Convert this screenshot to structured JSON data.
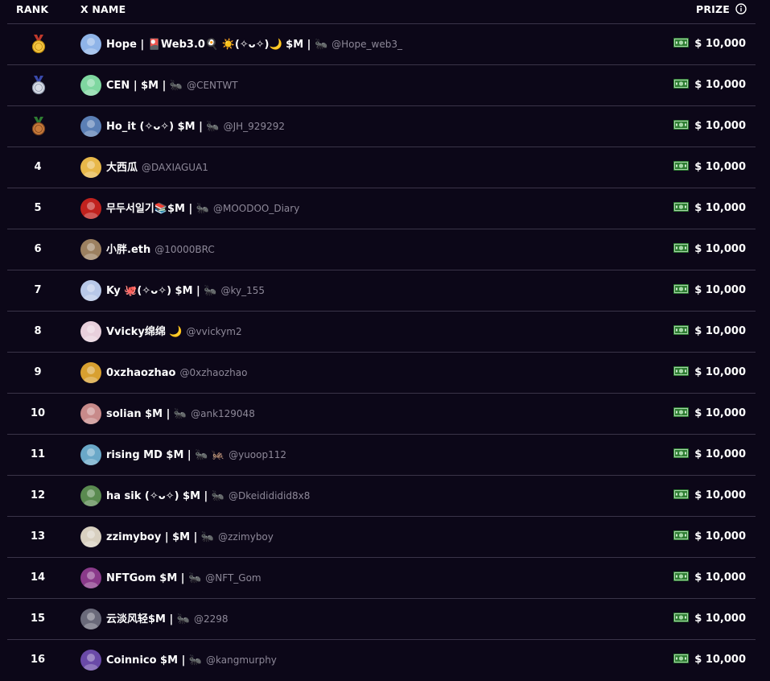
{
  "header": {
    "rank": "RANK",
    "name": "X NAME",
    "prize": "PRIZE"
  },
  "rows": [
    {
      "rank": "1",
      "medal": "gold-medal-icon",
      "name": "Hope | 🎴Web3.0🍳 ☀️(✧ᴗ✧)🌙 $M | 🐜",
      "handle": "@Hope_web3_",
      "prize": "$ 10,000",
      "avatar_color": "#8fb4e8"
    },
    {
      "rank": "2",
      "medal": "silver-medal-icon",
      "name": "CEN | $M | 🐜",
      "handle": "@CENTWT",
      "prize": "$ 10,000",
      "avatar_color": "#7fd7a0"
    },
    {
      "rank": "3",
      "medal": "bronze-medal-icon",
      "name": "Ho_it (✧ᴗ✧) $M | 🐜",
      "handle": "@JH_929292",
      "prize": "$ 10,000",
      "avatar_color": "#5b7fb5"
    },
    {
      "rank": "4",
      "name": "大西瓜",
      "handle": "@DAXIAGUA1",
      "prize": "$ 10,000",
      "avatar_color": "#e8b84a"
    },
    {
      "rank": "5",
      "name": "무두서일기📚$M | 🐜",
      "handle": "@MOODOO_Diary",
      "prize": "$ 10,000",
      "avatar_color": "#c0221e"
    },
    {
      "rank": "6",
      "name": "小胖.eth",
      "handle": "@10000BRC",
      "prize": "$ 10,000",
      "avatar_color": "#9c8060"
    },
    {
      "rank": "7",
      "name": "Ky 🐙(✧ᴗ✧) $M | 🐜",
      "handle": "@ky_155",
      "prize": "$ 10,000",
      "avatar_color": "#b8c8e8"
    },
    {
      "rank": "8",
      "name": "Vvicky绵绵 🌙",
      "handle": "@vvickym2",
      "prize": "$ 10,000",
      "avatar_color": "#e8d0dc"
    },
    {
      "rank": "9",
      "name": "0xzhaozhao",
      "handle": "@0xzhaozhao",
      "prize": "$ 10,000",
      "avatar_color": "#d8a030"
    },
    {
      "rank": "10",
      "name": "solian $M | 🐜",
      "handle": "@ank129048",
      "prize": "$ 10,000",
      "avatar_color": "#c88a8a"
    },
    {
      "rank": "11",
      "name": "rising MD $M | 🐜 🦗",
      "handle": "@yuoop112",
      "prize": "$ 10,000",
      "avatar_color": "#6aa8c8"
    },
    {
      "rank": "12",
      "name": "ha sik (✧ᴗ✧) $M | 🐜",
      "handle": "@Dkeidididid8x8",
      "prize": "$ 10,000",
      "avatar_color": "#5a8a50"
    },
    {
      "rank": "13",
      "name": "zzimyboy | $M | 🐜",
      "handle": "@zzimyboy",
      "prize": "$ 10,000",
      "avatar_color": "#d8d0c0"
    },
    {
      "rank": "14",
      "name": "NFTGom $M | 🐜",
      "handle": "@NFT_Gom",
      "prize": "$ 10,000",
      "avatar_color": "#8a3a8a"
    },
    {
      "rank": "15",
      "name": "云淡风轻$M | 🐜",
      "handle": "@2298",
      "prize": "$ 10,000",
      "avatar_color": "#6a6a7a"
    },
    {
      "rank": "16",
      "name": "Coinnico $M | 🐜",
      "handle": "@kangmurphy",
      "prize": "$ 10,000",
      "avatar_color": "#6a4aa8"
    }
  ]
}
